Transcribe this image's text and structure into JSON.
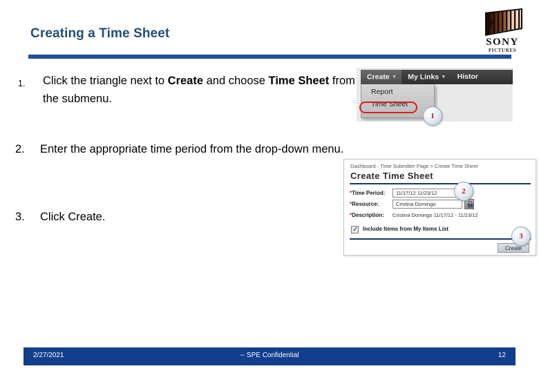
{
  "slide": {
    "title": "Creating a Time Sheet",
    "accent_rule_color": "#1F4E9B",
    "title_color": "#1F4E79"
  },
  "logo": {
    "brand": "SONY",
    "sub_brand": "PICTURES",
    "icon": "sony-pictures-columns-logo"
  },
  "steps": [
    {
      "number": "1.",
      "text_before": "Click the triangle next to ",
      "bold_1": "Create",
      "text_mid": " and choose ",
      "bold_2": "Time Sheet",
      "text_after": " from the submenu."
    },
    {
      "number": "2.",
      "text": "Enter the appropriate time period from the drop-down menu."
    },
    {
      "number": "3.",
      "text": "Click Create."
    }
  ],
  "screenshot_menu": {
    "menubar": [
      {
        "label": "Create",
        "caret": "▾"
      },
      {
        "label": "My Links",
        "caret": "▾"
      },
      {
        "label": "Histor",
        "caret": ""
      }
    ],
    "dropdown_items": [
      {
        "label": "Report"
      },
      {
        "label": "Time Sheet"
      }
    ],
    "highlight_color": "#E01B1B",
    "highlighted_item": "Time Sheet"
  },
  "screenshot_form": {
    "breadcrumb": "Dashboard - Time Submitter Page > Create Time Sheet",
    "title": "Create Time Sheet",
    "fields": [
      {
        "required_marker": "*",
        "label": "Time Period:",
        "value": "11/17/12  11/23/12",
        "arrow": "▼"
      },
      {
        "required_marker": "*",
        "label": "Resource:",
        "value": "Cristina Domingo",
        "button_icon": "lock-icon"
      },
      {
        "required_marker": "*",
        "label": "Description:",
        "value": "Cristina Domingo  11/17/12 - 11/23/12"
      }
    ],
    "checkbox": {
      "checked": true,
      "tick": "✓",
      "label": "Include Items from My Items List"
    },
    "create_button": "Create"
  },
  "callouts": [
    {
      "id": "1",
      "number": "1"
    },
    {
      "id": "2",
      "number": "2"
    },
    {
      "id": "3",
      "number": "3"
    }
  ],
  "footer": {
    "date": "2/27/2021",
    "confidential": "-- SPE Confidential",
    "page_number": "12",
    "background": "#133D8D"
  }
}
